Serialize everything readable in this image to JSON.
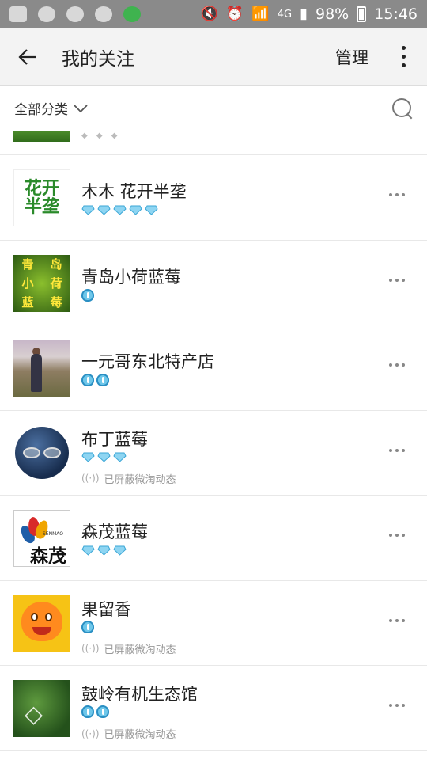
{
  "status_bar": {
    "network": "4G",
    "battery": "98%",
    "time": "15:46"
  },
  "toolbar": {
    "title": "我的关注",
    "manage_label": "管理"
  },
  "filter": {
    "label": "全部分类"
  },
  "shield_text": "已屏蔽微淘动态",
  "items": [
    {
      "name": "木木 花开半垄",
      "badge_type": "diamond",
      "badge_count": 5,
      "shielded": false,
      "thumb_text": [
        "花开",
        "半垄"
      ]
    },
    {
      "name": "青岛小荷蓝莓",
      "badge_type": "crown",
      "badge_count": 1,
      "shielded": false,
      "thumb_text": [
        "青",
        "岛",
        "小",
        "荷",
        "蓝",
        "莓"
      ]
    },
    {
      "name": "一元哥东北特产店",
      "badge_type": "crown",
      "badge_count": 2,
      "shielded": false
    },
    {
      "name": "布丁蓝莓",
      "badge_type": "diamond",
      "badge_count": 3,
      "shielded": true
    },
    {
      "name": "森茂蓝莓",
      "badge_type": "diamond",
      "badge_count": 3,
      "shielded": false,
      "thumb_text": [
        "森茂",
        "SENMAO"
      ]
    },
    {
      "name": "果留香",
      "badge_type": "crown",
      "badge_count": 1,
      "shielded": true
    },
    {
      "name": "鼓岭有机生态馆",
      "badge_type": "crown",
      "badge_count": 2,
      "shielded": true
    }
  ],
  "colors": {
    "status_bar_bg": "#8a8a8a",
    "toolbar_bg": "#f3f3f3",
    "diamond": "#6ec7ea",
    "crown": "#2a8fc3"
  }
}
